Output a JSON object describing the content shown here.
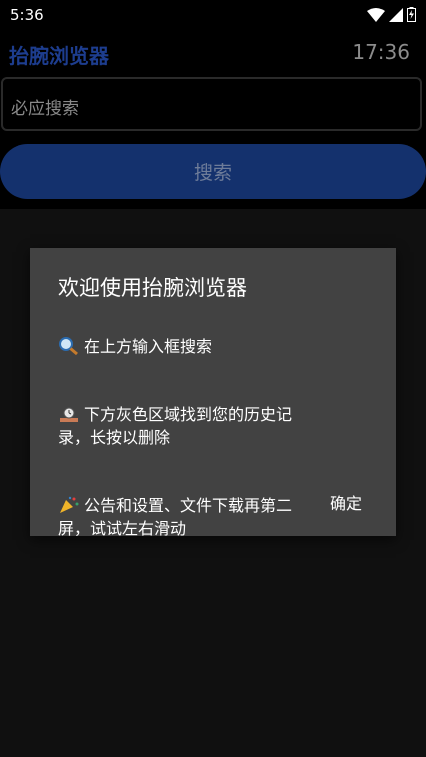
{
  "status_bar": {
    "time": "5:36",
    "icons": [
      "wifi-icon",
      "signal-icon",
      "battery-charging-icon"
    ]
  },
  "app_bar": {
    "title": "抬腕浏览器",
    "clock": "17:36"
  },
  "search": {
    "placeholder": "必应搜索",
    "button_label": "搜索"
  },
  "dialog": {
    "title": "欢迎使用抬腕浏览器",
    "lines": [
      {
        "icon": "magnifier-icon",
        "text": "在上方输入框搜索"
      },
      {
        "icon": "alarm-clock-icon",
        "text": "下方灰色区域找到您的历史记\n录，长按以删除"
      },
      {
        "icon": "party-popper-icon",
        "text": "公告和设置、文件下载再第二\n屏，试试左右滑动"
      }
    ],
    "ok_label": "确定"
  },
  "colors": {
    "accent": "#1d3d8f",
    "button_bg": "#14316d",
    "dialog_bg": "#424242",
    "history_bg": "#101010"
  }
}
